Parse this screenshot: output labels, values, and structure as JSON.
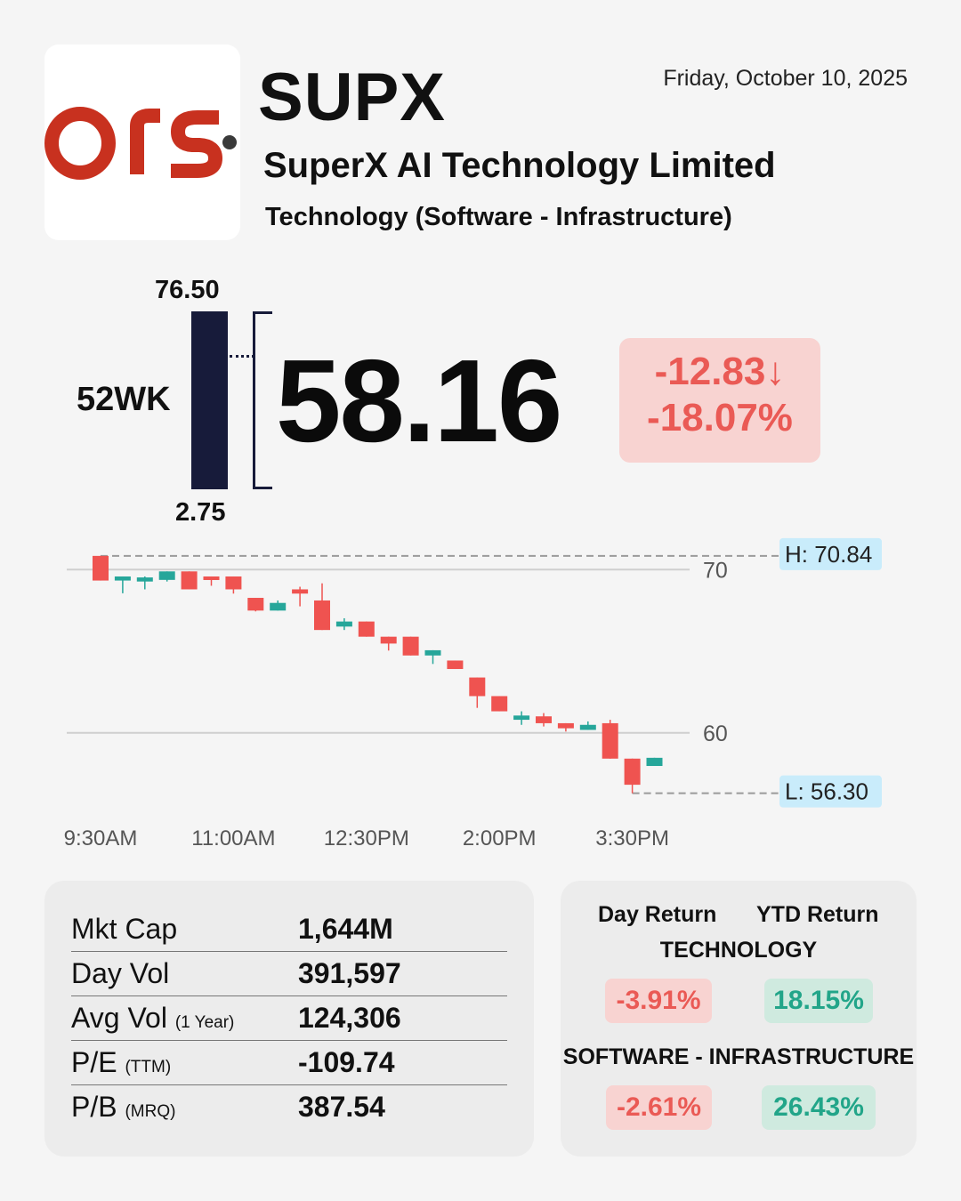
{
  "header": {
    "ticker": "SUPX",
    "date": "Friday, October 10, 2025",
    "company": "SuperX AI Technology Limited",
    "sector": "Technology (Software - Infrastructure)",
    "logo_icon": "ors-logo",
    "logo_color": "#c8311f"
  },
  "week52": {
    "label": "52WK",
    "high": "76.50",
    "low": "2.75"
  },
  "quote": {
    "price": "58.16",
    "change_abs": "-12.83↓",
    "change_pct": "-18.07%"
  },
  "chart_data": {
    "type": "candlestick",
    "x_tick_labels": [
      "9:30AM",
      "11:00AM",
      "12:30PM",
      "2:00PM",
      "3:30PM"
    ],
    "y_tick_labels": [
      "70",
      "60"
    ],
    "y_ticks": [
      70,
      60
    ],
    "ylim": [
      55.3,
      71.65
    ],
    "interval_minutes": 15,
    "high_label": "H: 70.84",
    "low_label": "L: 56.30",
    "high": 70.84,
    "low": 56.3,
    "up_color": "#26a69a",
    "down_color": "#ef5350",
    "candles": [
      {
        "t": "9:30AM",
        "o": 70.84,
        "h": 70.84,
        "l": 69.33,
        "c": 69.33
      },
      {
        "t": "9:45AM",
        "o": 69.33,
        "h": 69.58,
        "l": 68.55,
        "c": 69.58
      },
      {
        "t": "10:00AM",
        "o": 69.27,
        "h": 69.58,
        "l": 68.79,
        "c": 69.52
      },
      {
        "t": "10:15AM",
        "o": 69.37,
        "h": 69.89,
        "l": 69.27,
        "c": 69.89
      },
      {
        "t": "10:30AM",
        "o": 69.89,
        "h": 69.89,
        "l": 68.79,
        "c": 68.79
      },
      {
        "t": "10:45AM",
        "o": 69.58,
        "h": 69.58,
        "l": 69.01,
        "c": 69.37
      },
      {
        "t": "11:00AM",
        "o": 69.58,
        "h": 69.58,
        "l": 68.53,
        "c": 68.79
      },
      {
        "t": "11:15AM",
        "o": 68.27,
        "h": 68.27,
        "l": 67.44,
        "c": 67.49
      },
      {
        "t": "11:30AM",
        "o": 67.49,
        "h": 68.11,
        "l": 67.49,
        "c": 67.96
      },
      {
        "t": "11:45AM",
        "o": 68.79,
        "h": 68.95,
        "l": 67.75,
        "c": 68.53
      },
      {
        "t": "12:00PM",
        "o": 68.11,
        "h": 69.16,
        "l": 66.3,
        "c": 66.3
      },
      {
        "t": "12:15PM",
        "o": 66.51,
        "h": 67.02,
        "l": 66.3,
        "c": 66.82
      },
      {
        "t": "12:30PM",
        "o": 66.82,
        "h": 66.82,
        "l": 65.89,
        "c": 65.89
      },
      {
        "t": "12:45PM",
        "o": 65.89,
        "h": 65.89,
        "l": 65.04,
        "c": 65.47
      },
      {
        "t": "1:00PM",
        "o": 65.89,
        "h": 65.89,
        "l": 64.74,
        "c": 64.74
      },
      {
        "t": "1:15PM",
        "o": 64.74,
        "h": 65.06,
        "l": 64.22,
        "c": 65.06
      },
      {
        "t": "1:30PM",
        "o": 64.43,
        "h": 64.43,
        "l": 63.91,
        "c": 63.91
      },
      {
        "t": "1:45PM",
        "o": 63.39,
        "h": 63.39,
        "l": 61.53,
        "c": 62.25
      },
      {
        "t": "2:00PM",
        "o": 62.25,
        "h": 62.25,
        "l": 61.32,
        "c": 61.32
      },
      {
        "t": "2:15PM",
        "o": 60.8,
        "h": 61.32,
        "l": 60.49,
        "c": 61.06
      },
      {
        "t": "2:30PM",
        "o": 61.01,
        "h": 61.21,
        "l": 60.39,
        "c": 60.59
      },
      {
        "t": "2:45PM",
        "o": 60.59,
        "h": 60.59,
        "l": 60.08,
        "c": 60.28
      },
      {
        "t": "3:00PM",
        "o": 60.18,
        "h": 60.7,
        "l": 60.18,
        "c": 60.49
      },
      {
        "t": "3:15PM",
        "o": 60.59,
        "h": 60.8,
        "l": 58.42,
        "c": 58.42
      },
      {
        "t": "3:30PM",
        "o": 58.42,
        "h": 58.42,
        "l": 56.3,
        "c": 56.82
      },
      {
        "t": "3:45PM",
        "o": 57.97,
        "h": 58.47,
        "l": 57.97,
        "c": 58.47
      }
    ]
  },
  "stats": {
    "rows": [
      {
        "label": "Mkt Cap",
        "sub": "",
        "value": "1,644M"
      },
      {
        "label": "Day Vol",
        "sub": "",
        "value": "391,597"
      },
      {
        "label": "Avg Vol",
        "sub": "(1 Year)",
        "value": "124,306"
      },
      {
        "label": "P/E",
        "sub": "(TTM)",
        "value": "-109.74"
      },
      {
        "label": "P/B",
        "sub": "(MRQ)",
        "value": "387.54"
      }
    ]
  },
  "returns": {
    "day_header": "Day Return",
    "ytd_header": "YTD Return",
    "groups": [
      {
        "name": "TECHNOLOGY",
        "day": "-3.91%",
        "ytd": "18.15%"
      },
      {
        "name": "SOFTWARE - INFRASTRUCTURE",
        "day": "-2.61%",
        "ytd": "26.43%"
      }
    ]
  }
}
